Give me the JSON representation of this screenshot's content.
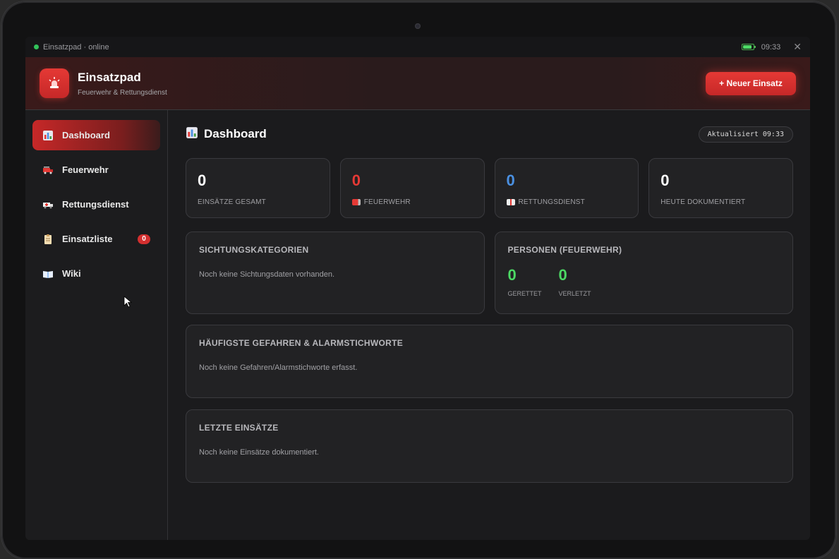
{
  "status": {
    "app_status": "Einsatzpad · online",
    "time": "09:33",
    "battery_level": 0.9
  },
  "header": {
    "title": "Einsatzpad",
    "subtitle": "Feuerwehr & Rettungsdienst",
    "new_button": "+ Neuer Einsatz"
  },
  "sidebar": {
    "items": [
      {
        "label": "Dashboard",
        "icon": "bar-chart-icon",
        "active": true
      },
      {
        "label": "Feuerwehr",
        "icon": "fire-truck-icon"
      },
      {
        "label": "Rettungsdienst",
        "icon": "ambulance-icon"
      },
      {
        "label": "Einsatzliste",
        "icon": "clipboard-icon",
        "badge": "0"
      },
      {
        "label": "Wiki",
        "icon": "book-icon"
      }
    ]
  },
  "main": {
    "title": "Dashboard",
    "updated": "Aktualisiert 09:33",
    "stats": [
      {
        "value": "0",
        "label": "EINSÄTZE GESAMT",
        "color": "#ffffff"
      },
      {
        "value": "0",
        "label": "FEUERWEHR",
        "color": "#e53935",
        "icon": "fire-truck-icon"
      },
      {
        "value": "0",
        "label": "RETTUNGSDIENST",
        "color": "#4a90e2",
        "icon": "ambulance-icon"
      },
      {
        "value": "0",
        "label": "HEUTE DOKUMENTIERT",
        "color": "#ffffff"
      }
    ],
    "triage": {
      "title": "SICHTUNGSKATEGORIEN",
      "empty": "Noch keine Sichtungsdaten vorhanden."
    },
    "persons": {
      "title": "PERSONEN (FEUERWEHR)",
      "rescued_value": "0",
      "rescued_label": "GERETTET",
      "injured_value": "0",
      "injured_label": "VERLETZT"
    },
    "hazards": {
      "title": "HÄUFIGSTE GEFAHREN & ALARMSTICHWORTE",
      "empty": "Noch keine Gefahren/Alarmstichworte erfasst."
    },
    "recent": {
      "title": "LETZTE EINSÄTZE",
      "empty": "Noch keine Einsätze dokumentiert."
    }
  }
}
